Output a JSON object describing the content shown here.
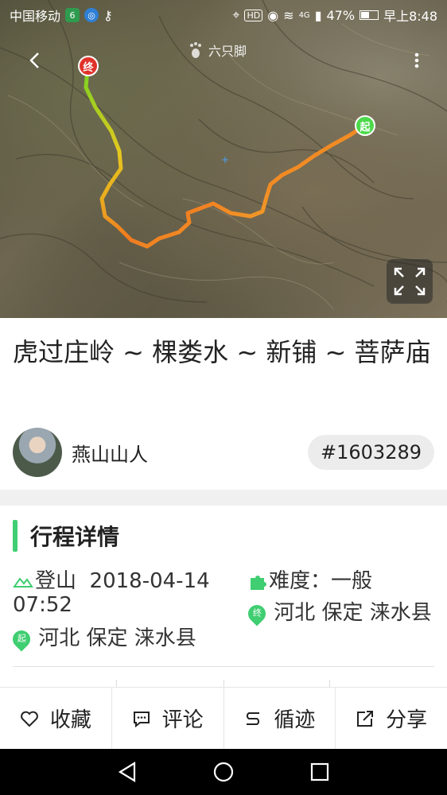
{
  "status_bar": {
    "carrier": "中国移动",
    "battery": "47%",
    "time": "早上8:48",
    "network": "4G"
  },
  "map": {
    "brand": "六只脚",
    "start_marker": "起",
    "end_marker": "终"
  },
  "track": {
    "title": "虎过庄岭 ~ 棵娄水 ~ 新铺 ~ 菩萨庙",
    "author": "燕山山人",
    "id": "#1603289"
  },
  "section": {
    "title": "行程详情"
  },
  "details": {
    "activity": "登山",
    "start_time": "2018-04-14 07:52",
    "start_location": "河北 保定 涞水县",
    "difficulty_label": "难度",
    "difficulty_value": "一般",
    "end_location": "河北 保定 涞水县",
    "start_icon_text": "起",
    "end_icon_text": "终"
  },
  "actions": [
    {
      "label": "收藏",
      "icon": "heart-icon"
    },
    {
      "label": "评论",
      "icon": "comment-icon"
    },
    {
      "label": "循迹",
      "icon": "route-icon"
    },
    {
      "label": "分享",
      "icon": "share-icon"
    }
  ],
  "colors": {
    "accent": "#3fce71",
    "start": "#4cd94a",
    "end": "#e0322a"
  }
}
